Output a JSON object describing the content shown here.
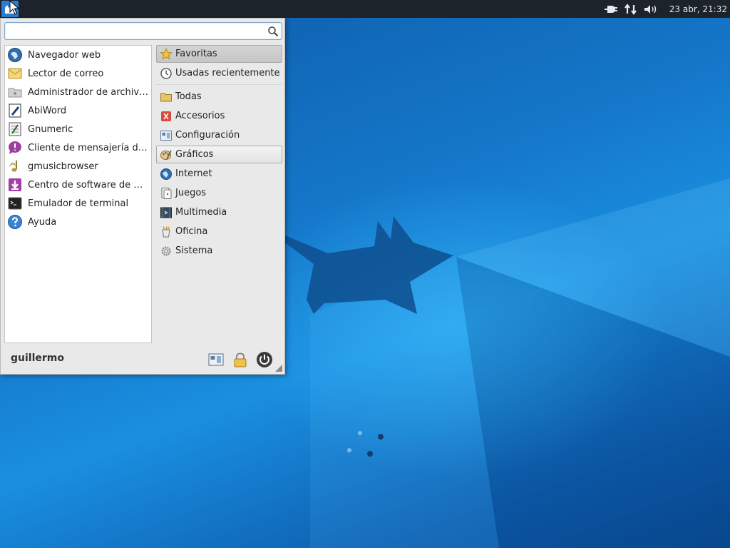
{
  "panel": {
    "clock": "23 abr, 21:32",
    "icons": [
      "whisker-menu-icon",
      "power-plug-icon",
      "network-icon",
      "volume-icon"
    ]
  },
  "menu": {
    "search": {
      "value": "",
      "placeholder": ""
    },
    "favorites": [
      {
        "label": "Navegador web",
        "icon": "web-browser-icon"
      },
      {
        "label": "Lector de correo",
        "icon": "mail-reader-icon"
      },
      {
        "label": "Administrador de archivos",
        "icon": "file-manager-icon"
      },
      {
        "label": "AbiWord",
        "icon": "abiword-icon"
      },
      {
        "label": "Gnumeric",
        "icon": "gnumeric-icon"
      },
      {
        "label": "Cliente de mensajería de In...",
        "icon": "messaging-client-icon"
      },
      {
        "label": "gmusicbrowser",
        "icon": "music-note-icon"
      },
      {
        "label": "Centro de software de Ubu...",
        "icon": "software-center-icon"
      },
      {
        "label": "Emulador de terminal",
        "icon": "terminal-icon"
      },
      {
        "label": "Ayuda",
        "icon": "help-icon"
      }
    ],
    "categories_top": [
      {
        "label": "Favoritas",
        "icon": "star-icon",
        "state": "selected"
      },
      {
        "label": "Usadas recientemente",
        "icon": "clock-icon",
        "state": ""
      }
    ],
    "categories": [
      {
        "label": "Todas",
        "icon": "folder-icon",
        "state": ""
      },
      {
        "label": "Accesorios",
        "icon": "accessories-icon",
        "state": ""
      },
      {
        "label": "Configuración",
        "icon": "settings-icon",
        "state": ""
      },
      {
        "label": "Gráficos",
        "icon": "graphics-icon",
        "state": "hover"
      },
      {
        "label": "Internet",
        "icon": "globe-icon",
        "state": ""
      },
      {
        "label": "Juegos",
        "icon": "games-icon",
        "state": ""
      },
      {
        "label": "Multimedia",
        "icon": "multimedia-icon",
        "state": ""
      },
      {
        "label": "Oficina",
        "icon": "office-icon",
        "state": ""
      },
      {
        "label": "Sistema",
        "icon": "system-gear-icon",
        "state": ""
      }
    ],
    "username": "guillermo",
    "actions": [
      "settings-manager-icon",
      "lock-screen-icon",
      "power-icon"
    ]
  },
  "colors": {
    "desktop": "#1577c9",
    "panel": "#1d232b",
    "menu_bg": "#e9e9e9",
    "accent": "#2a7fd4"
  }
}
